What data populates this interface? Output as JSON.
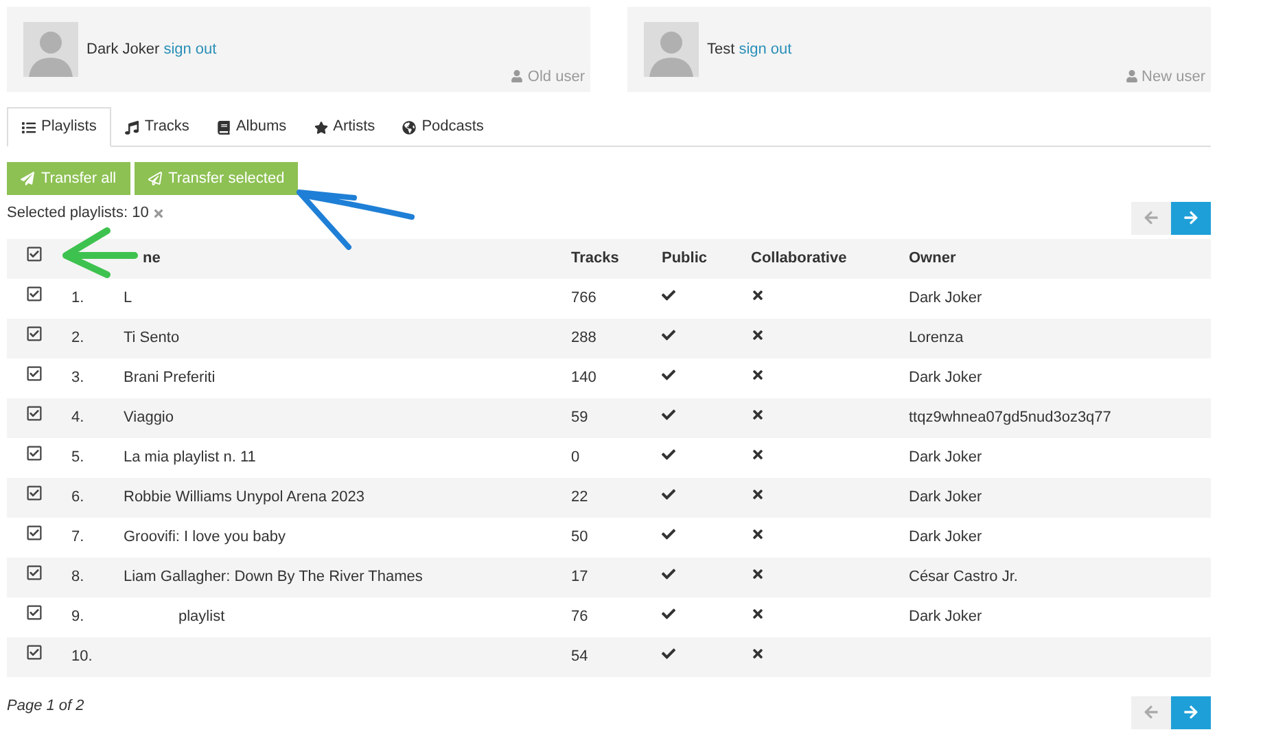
{
  "users": [
    {
      "name": "Dark Joker",
      "link": "sign out",
      "role": "Old user"
    },
    {
      "name": "Test",
      "link": "sign out",
      "role": "New user"
    }
  ],
  "tabs": [
    {
      "label": "Playlists",
      "selected": true
    },
    {
      "label": "Tracks",
      "selected": false
    },
    {
      "label": "Albums",
      "selected": false
    },
    {
      "label": "Artists",
      "selected": false
    },
    {
      "label": "Podcasts",
      "selected": false
    }
  ],
  "actions": [
    {
      "label": "Transfer all",
      "kind": "all"
    },
    {
      "label": "Transfer selected",
      "kind": "selected"
    }
  ],
  "selection": {
    "text": "Selected playlists: 10"
  },
  "pager_top": {
    "prev_disabled": true,
    "next_disabled": false
  },
  "table": {
    "all_checked": true,
    "columns": [
      "",
      "ne",
      "Tracks",
      "Public",
      "Collaborative",
      "Owner"
    ],
    "rows": [
      {
        "checked": true,
        "number": "1.",
        "name": "L",
        "tracks": "766",
        "public": true,
        "collaborative": false,
        "owner": "Dark Joker"
      },
      {
        "checked": true,
        "number": "2.",
        "name": "Ti Sento",
        "tracks": "288",
        "public": true,
        "collaborative": false,
        "owner": "Lorenza"
      },
      {
        "checked": true,
        "number": "3.",
        "name": "Brani Preferiti",
        "tracks": "140",
        "public": true,
        "collaborative": false,
        "owner": "Dark Joker"
      },
      {
        "checked": true,
        "number": "4.",
        "name": "Viaggio",
        "tracks": "59",
        "public": true,
        "collaborative": false,
        "owner": "ttqz9whnea07gd5nud3oz3q77"
      },
      {
        "checked": true,
        "number": "5.",
        "name": "La mia playlist n. 11",
        "tracks": "0",
        "public": true,
        "collaborative": false,
        "owner": "Dark Joker"
      },
      {
        "checked": true,
        "number": "6.",
        "name": "Robbie Williams Unypol Arena 2023",
        "tracks": "22",
        "public": true,
        "collaborative": false,
        "owner": "Dark Joker"
      },
      {
        "checked": true,
        "number": "7.",
        "name": "Groovifi: I love you baby",
        "tracks": "50",
        "public": true,
        "collaborative": false,
        "owner": "Dark Joker"
      },
      {
        "checked": true,
        "number": "8.",
        "name": "Liam Gallagher: Down By The River Thames",
        "tracks": "17",
        "public": true,
        "collaborative": false,
        "owner": "César Castro Jr."
      },
      {
        "checked": true,
        "number": "9.",
        "name": "playlist",
        "tracks": "76",
        "public": true,
        "collaborative": false,
        "owner": "Dark Joker"
      },
      {
        "checked": true,
        "number": "10.",
        "tracks": "54",
        "public": true,
        "collaborative": false
      }
    ]
  },
  "footer": {
    "page": "Page 1 of 2"
  },
  "pager_bottom": {
    "prev_disabled": true,
    "next_disabled": false
  }
}
